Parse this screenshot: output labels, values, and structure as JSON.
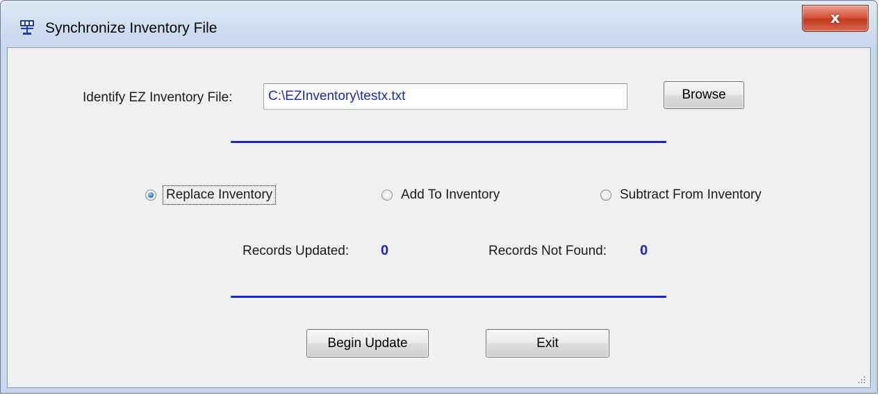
{
  "window": {
    "title": "Synchronize Inventory File",
    "close_glyph": "x",
    "app_icon": "computer-network-icon"
  },
  "file": {
    "label": "Identify EZ Inventory File:",
    "value": "C:\\EZInventory\\testx.txt",
    "browse_label": "Browse"
  },
  "mode": {
    "options": [
      {
        "label": "Replace Inventory",
        "checked": true
      },
      {
        "label": "Add To Inventory",
        "checked": false
      },
      {
        "label": "Subtract From Inventory",
        "checked": false
      }
    ]
  },
  "stats": {
    "updated_label": "Records Updated:",
    "updated_value": "0",
    "not_found_label": "Records Not Found:",
    "not_found_value": "0"
  },
  "actions": {
    "begin_label": "Begin Update",
    "exit_label": "Exit"
  },
  "colors": {
    "accent": "#1b26c9",
    "input_text": "#1b2bb0",
    "close_button": "#c1391f"
  }
}
